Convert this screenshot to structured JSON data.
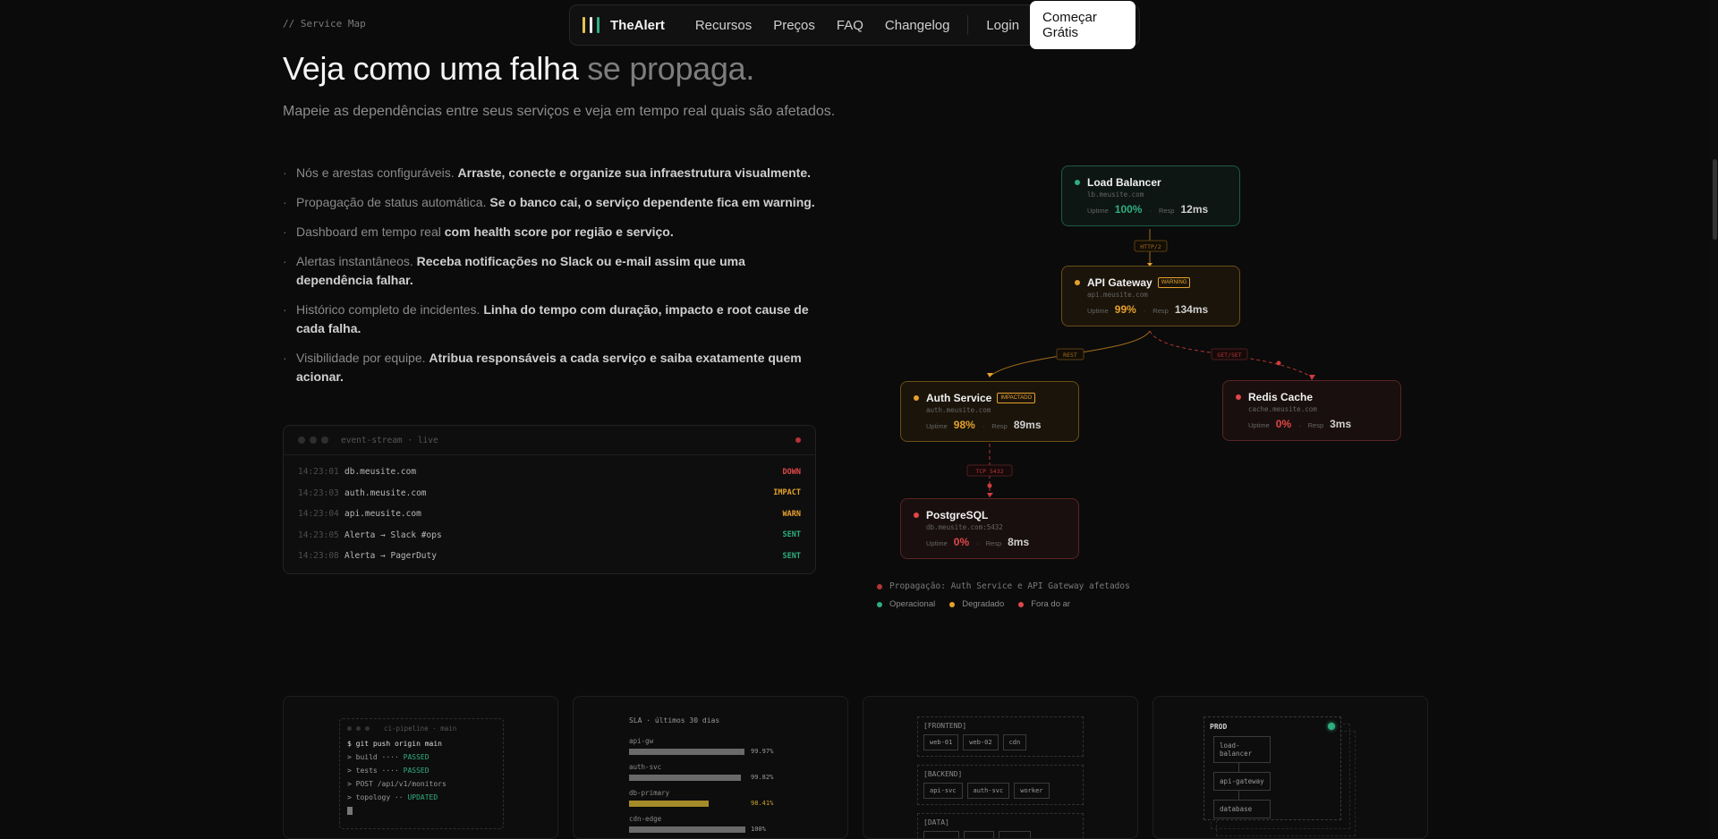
{
  "nav": {
    "brand": "TheAlert",
    "brand_bar_colors": [
      "#e6c24a",
      "#e8e8e8",
      "#2fae7f"
    ],
    "links": [
      "Recursos",
      "Preços",
      "FAQ",
      "Changelog"
    ],
    "login": "Login",
    "cta": "Começar Grátis"
  },
  "hero": {
    "eyebrow": "// Service Map",
    "title_main": "Veja como uma falha",
    "title_dim": "se propaga.",
    "subtitle": "Mapeie as dependências entre seus serviços e veja em tempo real quais são afetados."
  },
  "features": [
    {
      "lead": "Nós e arestas configuráveis.",
      "bold": "Arraste, conecte e organize sua infraestrutura visualmente."
    },
    {
      "lead": "Propagação de status automática.",
      "bold": "Se o banco cai, o serviço dependente fica em warning."
    },
    {
      "lead": "Dashboard em tempo real",
      "bold": "com health score por região e serviço."
    },
    {
      "lead": "Alertas instantâneos.",
      "bold": "Receba notificações no Slack ou e-mail assim que uma dependência falhar."
    },
    {
      "lead": "Histórico completo de incidentes.",
      "bold": "Linha do tempo com duração, impacto e root cause de cada falha."
    },
    {
      "lead": "Visibilidade por equipe.",
      "bold": "Atribua responsáveis a cada serviço e saiba exatamente quem acionar."
    }
  ],
  "terminal": {
    "title": "event-stream · live",
    "rows": [
      {
        "time": "14:23:01",
        "message": "db.meusite.com",
        "status": "DOWN",
        "color": "#e04848"
      },
      {
        "time": "14:23:03",
        "message": "auth.meusite.com",
        "status": "IMPACT",
        "color": "#e5a12c"
      },
      {
        "time": "14:23:04",
        "message": "api.meusite.com",
        "status": "WARN",
        "color": "#e5a12c"
      },
      {
        "time": "14:23:05",
        "message": "Alerta → Slack #ops",
        "status": "SENT",
        "color": "#2fae7f"
      },
      {
        "time": "14:23:08",
        "message": "Alerta → PagerDuty",
        "status": "SENT",
        "color": "#2fae7f"
      }
    ]
  },
  "service_map": {
    "uptime_label": "Uptime",
    "resp_label": "Resp",
    "nodes": {
      "lb": {
        "name": "Load Balancer",
        "host": "lb.meusite.com",
        "uptime": "100%",
        "resp": "12ms",
        "status": "operational",
        "color": "#2fae7f"
      },
      "api": {
        "name": "API Gateway",
        "badge": "WARNING",
        "host": "api.meusite.com",
        "uptime": "99%",
        "resp": "134ms",
        "status": "degraded",
        "color": "#e5a12c"
      },
      "auth": {
        "name": "Auth Service",
        "badge": "IMPACTADO",
        "host": "auth.meusite.com",
        "uptime": "98%",
        "resp": "89ms",
        "status": "degraded",
        "color": "#e5a12c"
      },
      "redis": {
        "name": "Redis Cache",
        "host": "cache.meusite.com",
        "uptime": "0%",
        "resp": "3ms",
        "status": "down",
        "color": "#e04848"
      },
      "pg": {
        "name": "PostgreSQL",
        "host": "db.meusite.com:5432",
        "uptime": "0%",
        "resp": "8ms",
        "status": "down",
        "color": "#e04848"
      }
    },
    "edges": {
      "lb_api": "HTTP/2",
      "api_auth": "REST",
      "api_redis": "GET/SET",
      "auth_pg": "TCP 5432"
    },
    "propagation_note": "Propagação: Auth Service e API Gateway afetados",
    "legend": [
      {
        "label": "Operacional",
        "color": "#2fae7f"
      },
      {
        "label": "Degradado",
        "color": "#e5a12c"
      },
      {
        "label": "Fora do ar",
        "color": "#e04848"
      }
    ]
  },
  "cards": {
    "ci": {
      "title": "ci-pipeline · main",
      "command": "$ git push origin main",
      "lines": [
        {
          "text": "> build ···· ",
          "status": "PASSED"
        },
        {
          "text": "> tests ···· ",
          "status": "PASSED"
        },
        {
          "text": "> POST /api/v1/monitors",
          "status": ""
        },
        {
          "text": "> topology ·· ",
          "status": "UPDATED"
        }
      ]
    },
    "sla": {
      "title": "SLA · últimos 30 dias",
      "items": [
        {
          "name": "api-gw",
          "pct": "99.97%",
          "fill": 0.9997,
          "color": "#6a6a6a"
        },
        {
          "name": "auth-svc",
          "pct": "99.82%",
          "fill": 0.9982,
          "color": "#6a6a6a"
        },
        {
          "name": "db-primary",
          "pct": "98.41%",
          "fill": 0.9841,
          "color": "#a58a2a"
        },
        {
          "name": "cdn-edge",
          "pct": "100%",
          "fill": 1,
          "color": "#6a6a6a"
        }
      ]
    },
    "topology": {
      "groups": [
        {
          "label": "[FRONTEND]",
          "chips": [
            "web-01",
            "web-02",
            "cdn"
          ]
        },
        {
          "label": "[BACKEND]",
          "chips": [
            "api-svc",
            "auth-svc",
            "worker"
          ]
        },
        {
          "label": "[DATA]",
          "chips": [
            "",
            "",
            ""
          ]
        }
      ]
    },
    "prod": {
      "label": "PROD",
      "nodes": [
        "load-balancer",
        "api-gateway",
        "database"
      ]
    }
  }
}
